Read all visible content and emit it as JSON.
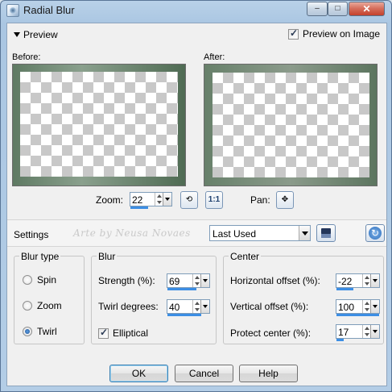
{
  "window": {
    "title": "Radial Blur",
    "minimize": "–",
    "maximize": "□",
    "close": "✕"
  },
  "preview": {
    "toggle_label": "Preview",
    "preview_on_image_label": "Preview on Image",
    "preview_on_image_checked": true,
    "before_label": "Before:",
    "after_label": "After:"
  },
  "zoom": {
    "label": "Zoom:",
    "value": "22",
    "pan_label": "Pan:",
    "fit_icon": "⟲",
    "actual_label": "1:1",
    "pan_icon": "✥"
  },
  "settings": {
    "label": "Settings",
    "watermark": "Arte by Neusa Novaes",
    "preset_value": "Last Used"
  },
  "blur_type": {
    "title": "Blur type",
    "options": [
      {
        "label": "Spin",
        "selected": false
      },
      {
        "label": "Zoom",
        "selected": false
      },
      {
        "label": "Twirl",
        "selected": true
      }
    ]
  },
  "blur": {
    "title": "Blur",
    "strength_label": "Strength (%):",
    "strength_value": "69",
    "strength_fraction": 0.69,
    "twirl_label": "Twirl degrees:",
    "twirl_value": "40",
    "twirl_fraction": 0.8,
    "elliptical_label": "Elliptical",
    "elliptical_checked": true
  },
  "center": {
    "title": "Center",
    "h_offset_label": "Horizontal offset (%):",
    "h_offset_value": "-22",
    "h_offset_fraction": 0.39,
    "v_offset_label": "Vertical offset (%):",
    "v_offset_value": "100",
    "v_offset_fraction": 1.0,
    "protect_label": "Protect center (%):",
    "protect_value": "17",
    "protect_fraction": 0.17
  },
  "buttons": {
    "ok": "OK",
    "cancel": "Cancel",
    "help": "Help"
  }
}
